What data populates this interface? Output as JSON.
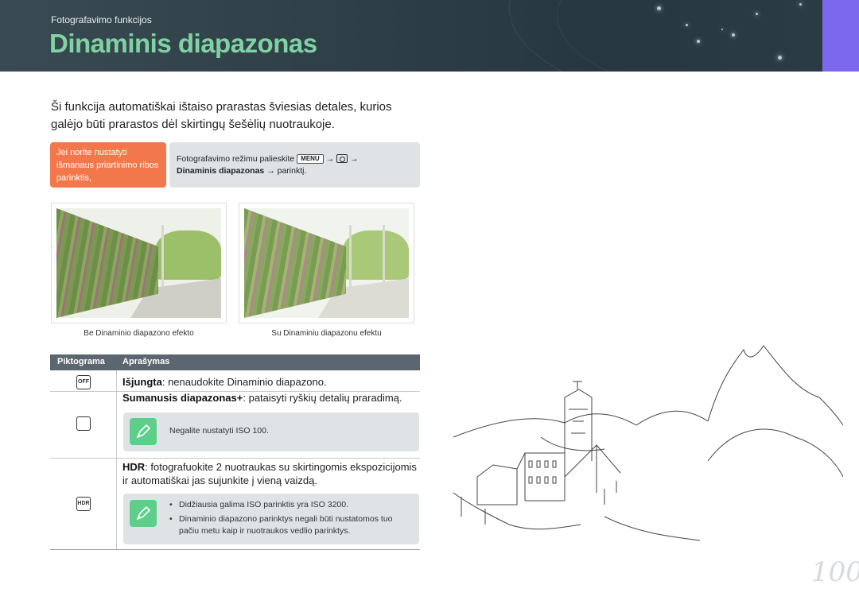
{
  "header": {
    "section": "Fotografavimo funkcijos",
    "title": "Dinaminis diapazonas"
  },
  "intro": "Ši funkcija automatiškai ištaiso prarastas šviesias detales, kurios galėjo būti prarastos dėl skirtingų šešėlių nuotraukoje.",
  "instruction": {
    "condition": "Jei norite nustatyti išmanaus priartinimo ribos parinktis,",
    "step_prefix": "Fotografavimo režimu palieskite",
    "menu_key": "MENU",
    "arrow": "→",
    "step_bold": "Dinaminis diapazonas",
    "step_suffix": "→ parinktį."
  },
  "photos": [
    {
      "caption": "Be Dinaminio diapazono efekto"
    },
    {
      "caption": "Su Dinaminiu diapazonu efektu"
    }
  ],
  "table": {
    "col_icon": "Piktograma",
    "col_desc": "Aprašymas",
    "rows": [
      {
        "icon": "OFF",
        "label": "Išjungta",
        "text": ": nenaudokite Dinaminio diapazono."
      },
      {
        "label": "Sumanusis diapazonas+",
        "text": ": pataisyti ryškių detalių praradimą.",
        "note": "Negalite nustatyti ISO 100."
      },
      {
        "icon": "HDR",
        "label": "HDR",
        "text": ": fotografuokite 2 nuotraukas su skirtingomis ekspozicijomis ir automatiškai jas sujunkite į vieną vaizdą.",
        "notes": [
          "Didžiausia galima ISO parinktis yra ISO 3200.",
          "Dinaminio diapazono parinktys negali būti nustatomos tuo pačiu metu kaip ir nuotraukos vedlio parinktys."
        ]
      }
    ]
  },
  "page_number": "100",
  "colors": {
    "title": "#7fd3a3",
    "orange": "#f2784b",
    "side_tab": "#7b68ee",
    "note_badge": "#5ecf8b"
  }
}
